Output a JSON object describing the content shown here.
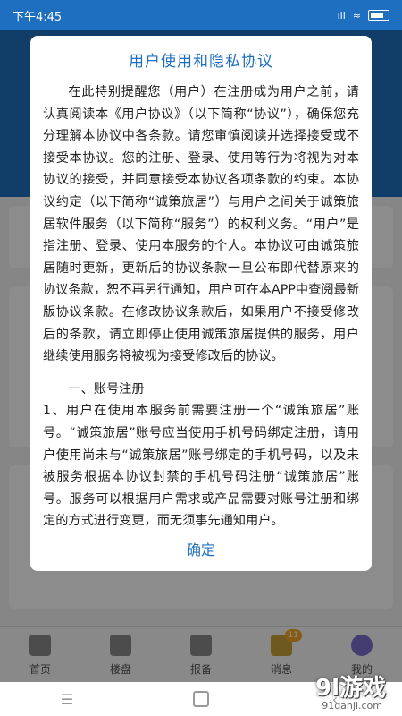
{
  "status_bar": {
    "time": "下午4:45",
    "signal": "ıll",
    "wifi": "≈"
  },
  "dialog": {
    "title": "用户使用和隐私协议",
    "paragraph_1": "在此特别提醒您（用户）在注册成为用户之前，请认真阅读本《用户协议》（以下简称“协议”），确保您充分理解本协议中各条款。请您审慎阅读并选择接受或不接受本协议。您的注册、登录、使用等行为将视为对本协议的接受，并同意接受本协议各项条款的约束。本协议约定（以下简称“诚策旅居”）与用户之间关于诚策旅居软件服务（以下简称“服务”）的权利义务。“用户”是指注册、登录、使用本服务的个人。本协议可由诚策旅居随时更新，更新后的协议条款一旦公布即代替原来的协议条款，恕不再另行通知，用户可在本APP中查阅最新版协议条款。在修改协议条款后，如果用户不接受修改后的条款，请立即停止使用诚策旅居提供的服务，用户继续使用服务将被视为接受修改后的协议。",
    "section_1_title": "一、账号注册",
    "section_1_text": "1、用户在使用本服务前需要注册一个“诚策旅居”账号。“诚策旅居”账号应当使用手机号码绑定注册，请用户使用尚未与“诚策旅居”账号绑定的手机号码，以及未被服务根据本协议封禁的手机号码注册“诚策旅居”账号。服务可以根据用户需求或产品需要对账号注册和绑定的方式进行变更，而无须事先通知用户。",
    "confirm_label": "确定"
  },
  "tab_bar": {
    "items": [
      {
        "label": "首页",
        "icon": "home-icon"
      },
      {
        "label": "楼盘",
        "icon": "building-icon"
      },
      {
        "label": "报备",
        "icon": "edit-icon"
      },
      {
        "label": "消息",
        "icon": "message-icon",
        "badge": "11"
      },
      {
        "label": "我的",
        "icon": "profile-icon"
      }
    ]
  },
  "watermark": {
    "logo": "9l游戏",
    "url": "91danji.com"
  },
  "colors": {
    "accent": "#1f6fc0",
    "badge": "#f5a623"
  }
}
